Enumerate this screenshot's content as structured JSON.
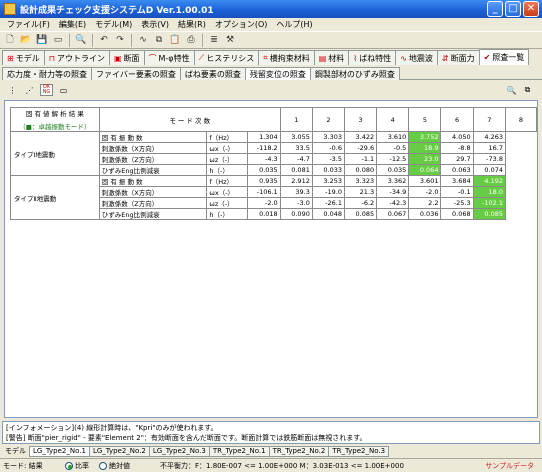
{
  "window": {
    "title": "設計成果チェック支援システムD Ver.1.00.01",
    "min": "_",
    "max": "□",
    "close": "✕"
  },
  "menu": [
    "ファイル(F)",
    "編集(E)",
    "モデル(M)",
    "表示(V)",
    "結果(R)",
    "オプション(O)",
    "ヘルプ(H)"
  ],
  "main_tabs": [
    "モデル",
    "アウトライン",
    "断面",
    "M-φ特性",
    "ヒステリシス",
    "横拘束材料",
    "材料",
    "ばね特性",
    "地震波",
    "断面力",
    "照査一覧"
  ],
  "sub_tabs": [
    "応力度・耐力等の照査",
    "ファイバー要素の照査",
    "ばね要素の照査",
    "残留変位の照査",
    "鋼製部材のひずみ照査"
  ],
  "subtool_ok": [
    "OK",
    "NG"
  ],
  "table": {
    "left_title": "固 有 値 解 析 結 果",
    "left_legend": "（■：卓越振動モード）",
    "mode_header": "モ ー ド 次 数",
    "modes": [
      "1",
      "2",
      "3",
      "4",
      "5",
      "6",
      "7",
      "8"
    ],
    "groups": [
      {
        "type": "タイプⅠ地震動",
        "rows": [
          {
            "q": "固 有 振 動 数",
            "u": "f（Hz）",
            "v": [
              "1.304",
              "3.055",
              "3.303",
              "3.422",
              "3.610",
              "3.752",
              "4.050",
              "4.263"
            ],
            "hl": [
              5
            ]
          },
          {
            "q": "刺激係数（X方向）",
            "u": "ωx（-）",
            "v": [
              "-118.2",
              "33.5",
              "-0.6",
              "-29.6",
              "-0.5",
              "18.9",
              "-8.8",
              "16.7"
            ],
            "hl": [
              5
            ]
          },
          {
            "q": "刺激係数（Z方向）",
            "u": "ωz（-）",
            "v": [
              "-4.3",
              "-4.7",
              "-3.5",
              "-1.1",
              "-12.5",
              "23.0",
              "29.7",
              "-73.8"
            ],
            "hl": [
              5
            ]
          },
          {
            "q": "ひずみEng比例減衰",
            "u": "h（-）",
            "v": [
              "0.035",
              "0.081",
              "0.033",
              "0.080",
              "0.035",
              "0.064",
              "0.063",
              "0.074"
            ],
            "hl": [
              5
            ]
          }
        ]
      },
      {
        "type": "タイプⅡ地震動",
        "rows": [
          {
            "q": "固 有 振 動 数",
            "u": "f（Hz）",
            "v": [
              "0.935",
              "2.912",
              "3.253",
              "3.323",
              "3.362",
              "3.601",
              "3.684",
              "4.192"
            ],
            "hl": [
              7
            ]
          },
          {
            "q": "刺激係数（X方向）",
            "u": "ωx（-）",
            "v": [
              "-106.1",
              "39.3",
              "-19.0",
              "21.3",
              "-34.9",
              "-2.0",
              "-0.1",
              "18.0"
            ],
            "hl": [
              7
            ]
          },
          {
            "q": "刺激係数（Z方向）",
            "u": "ωz（-）",
            "v": [
              "-2.0",
              "-3.0",
              "-26.1",
              "-6.2",
              "-42.3",
              "2.2",
              "-25.3",
              "-102.1"
            ],
            "hl": [
              7
            ]
          },
          {
            "q": "ひずみEng比例減衰",
            "u": "h（-）",
            "v": [
              "0.018",
              "0.090",
              "0.048",
              "0.085",
              "0.067",
              "0.036",
              "0.068",
              "0.085"
            ],
            "hl": [
              7
            ]
          }
        ]
      }
    ]
  },
  "info": {
    "line1": "[インフォメーション](4) 線形計算時は、\"Kpri\"のみが使われます。",
    "line2": "[警告] 断面\"pier_rigid\" - 要素\"Element 2\"：有効断面を含んだ断面です。断面計算では鉄筋断面は無視されます。"
  },
  "model_bar": {
    "label": "モデル",
    "tabs": [
      "LG_Type2_No.1",
      "LG_Type2_No.2",
      "LG_Type2_No.3",
      "TR_Type2_No.1",
      "TR_Type2_No.2",
      "TR_Type2_No.3"
    ]
  },
  "status": {
    "mode": "モード: 結果",
    "radio1": "比率",
    "radio2": "絶対値",
    "balance": "不平衡力：F：1.80E-007 <= 1.00E+000  M：3.03E-013 <= 1.00E+000",
    "sample": "サンプルデータ"
  },
  "colors": {
    "highlight": "#66cc44",
    "title_bar": "#1b5fd6"
  }
}
